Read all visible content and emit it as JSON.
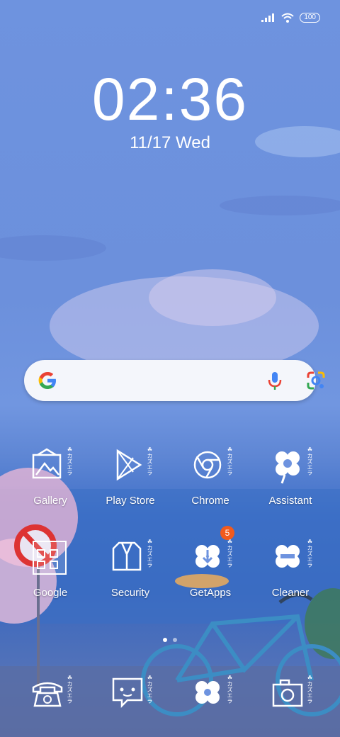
{
  "status": {
    "battery": "100"
  },
  "lockclock": {
    "time": "02:36",
    "date": "11/17 Wed"
  },
  "search": {
    "placeholder": ""
  },
  "apps_row1": [
    {
      "name": "Gallery",
      "icon": "gallery-icon"
    },
    {
      "name": "Play Store",
      "icon": "play-store-icon"
    },
    {
      "name": "Chrome",
      "icon": "chrome-icon"
    },
    {
      "name": "Assistant",
      "icon": "assistant-icon"
    }
  ],
  "apps_row2": [
    {
      "name": "Google",
      "icon": "google-folder-icon"
    },
    {
      "name": "Security",
      "icon": "security-icon"
    },
    {
      "name": "GetApps",
      "icon": "getapps-icon",
      "badge": "5"
    },
    {
      "name": "Cleaner",
      "icon": "cleaner-icon"
    }
  ],
  "dock": [
    {
      "icon": "phone-icon"
    },
    {
      "icon": "messages-icon"
    },
    {
      "icon": "browser-icon"
    },
    {
      "icon": "camera-icon"
    }
  ],
  "icon_tag": "☘カズエラ",
  "colors": {
    "badge": "#f25a1c",
    "accent_blue": "#4285f4"
  }
}
